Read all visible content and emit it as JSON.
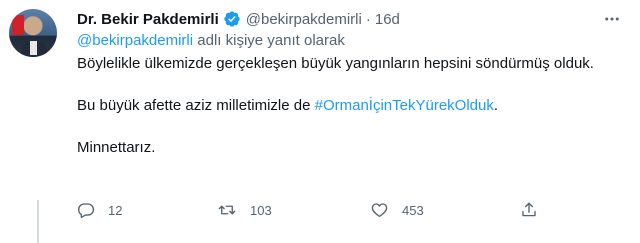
{
  "tweet": {
    "author_name": "Dr. Bekir Pakdemirli",
    "handle": "@bekirpakdemirli",
    "separator": "·",
    "time": "16d",
    "reply_to": {
      "mention": "@bekirpakdemirli",
      "suffix": " adlı kişiye yanıt olarak"
    },
    "body": {
      "line1": "Böylelikle ülkemizde gerçekleşen büyük yangınların hepsini söndürmüş olduk.",
      "line2_prefix": "Bu büyük afette aziz milletimizle de ",
      "hashtag": "#OrmanİçinTekYürekOlduk",
      "line2_suffix": ".",
      "line3": "Minnettarız."
    },
    "actions": {
      "replies": "12",
      "retweets": "103",
      "likes": "453"
    },
    "icons": {
      "avatar": "profile-photo",
      "verified": "verified-badge-icon",
      "more": "more-dots-icon",
      "reply": "reply-icon",
      "retweet": "retweet-icon",
      "like": "heart-icon",
      "share": "share-icon"
    },
    "colors": {
      "accent": "#1d9bf0",
      "secondary_text": "#536471",
      "primary_text": "#0f1419"
    }
  }
}
